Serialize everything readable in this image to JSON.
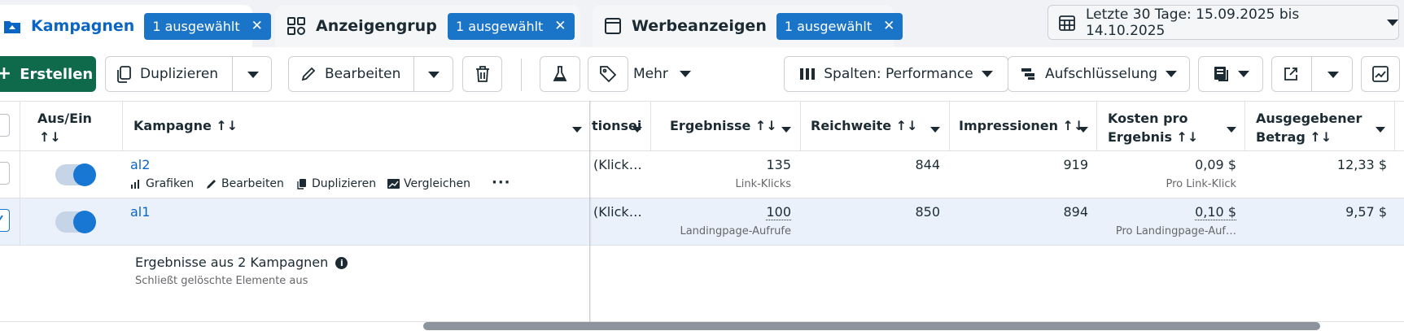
{
  "tabs": [
    {
      "label": "Kampagnen",
      "badge": "1 ausgewählt",
      "icon": "folder-icon",
      "active": true
    },
    {
      "label": "Anzeigengruppe",
      "badge": "1 ausgewählt",
      "icon": "grid-icon",
      "active": false
    },
    {
      "label": "Werbeanzeigen",
      "badge": "1 ausgewählt",
      "icon": "window-icon",
      "active": false
    }
  ],
  "date_range": {
    "label": "Letzte 30 Tage: 15.09.2025 bis 14.10.2025",
    "icon": "calendar-icon"
  },
  "toolbar": {
    "create_label": "Erstellen",
    "duplicate_label": "Duplizieren",
    "edit_label": "Bearbeiten",
    "more_label": "Mehr",
    "columns_label": "Spalten: Performance",
    "breakdown_label": "Aufschlüsselung"
  },
  "columns": {
    "on_off": [
      "Aus/Ein",
      "↑↓"
    ],
    "campaign": "Kampagne ↑↓",
    "conversion_partial": "tionseins",
    "results": "Ergebnisse ↑↓",
    "reach": "Reichweite ↑↓",
    "impressions": "Impressionen ↑↓",
    "cost_per_result": [
      "Kosten pro",
      "Ergebnis ↑↓"
    ],
    "amount_spent": [
      "Ausgegebener",
      "Betrag ↑↓"
    ]
  },
  "rows": [
    {
      "name": "al2",
      "conversion": "(Klick…",
      "results": "135",
      "results_sub": "Link-Klicks",
      "reach": "844",
      "impressions": "919",
      "cost": "0,09 $",
      "cost_sub": "Pro Link-Klick",
      "spent": "12,33 $",
      "actions": [
        "Grafiken",
        "Bearbeiten",
        "Duplizieren",
        "Vergleichen"
      ],
      "on": true,
      "selected": false
    },
    {
      "name": "al1",
      "conversion": "(Klick…",
      "results": "100",
      "results_sub": "Landingpage-Aufrufe",
      "reach": "850",
      "impressions": "894",
      "cost": "0,10 $",
      "cost_sub": "Pro Landingpage-Auf…",
      "spent": "9,57 $",
      "on": true,
      "selected": true
    }
  ],
  "summary": {
    "title": "Ergebnisse aus 2 Kampagnen",
    "note": "Schließt gelöschte Elemente aus"
  },
  "colors": {
    "accent": "#0a66c2",
    "create_button": "#0f6a4b",
    "selected_row": "#eaf1fb",
    "badge": "#1a74c8"
  }
}
